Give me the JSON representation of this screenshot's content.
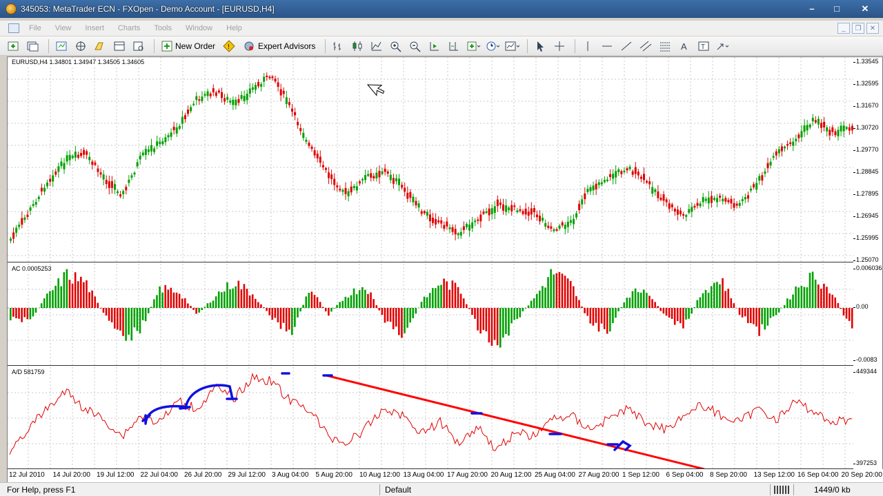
{
  "window": {
    "title": "345053: MetaTrader ECN - FXOpen - Demo Account - [EURUSD,H4]",
    "buttons": [
      "–",
      "□",
      "✕"
    ]
  },
  "menu": [
    "File",
    "View",
    "Insert",
    "Charts",
    "Tools",
    "Window",
    "Help"
  ],
  "toolbar": {
    "new_order": "New Order",
    "expert_advisors": "Expert Advisors"
  },
  "chart": {
    "main_label": "EURUSD,H4  1.34801 1.34947 1.34505 1.34605",
    "ac_label": "AC 0.0005253",
    "ad_label": "A/D 581759",
    "price_ticks": [
      "1.33545",
      "1.32595",
      "1.31670",
      "1.30720",
      "1.29770",
      "1.28845",
      "1.27895",
      "1.26945",
      "1.25995",
      "1.25070"
    ],
    "ac_ticks": [
      "0.006036",
      "0.00",
      "-0.0083"
    ],
    "ad_ticks": [
      "449344",
      "397253"
    ],
    "x_ticks": [
      "12 Jul 2010",
      "14 Jul 20:00",
      "19 Jul 12:00",
      "22 Jul 04:00",
      "26 Jul 20:00",
      "29 Jul 12:00",
      "3 Aug 04:00",
      "5 Aug 20:00",
      "10 Aug 12:00",
      "13 Aug 04:00",
      "17 Aug 20:00",
      "20 Aug 12:00",
      "25 Aug 04:00",
      "27 Aug 20:00",
      "1 Sep 12:00",
      "6 Sep 04:00",
      "8 Sep 20:00",
      "13 Sep 12:00",
      "16 Sep 04:00",
      "20 Sep 20:00"
    ],
    "colors": {
      "bull": "#00a000",
      "bear": "#e00000",
      "ad_line": "#e00000",
      "trendline": "#ff0000",
      "annotation": "#1010e0"
    }
  },
  "status": {
    "help": "For Help, press F1",
    "profile": "Default",
    "traffic": "1449/0 kb"
  }
}
